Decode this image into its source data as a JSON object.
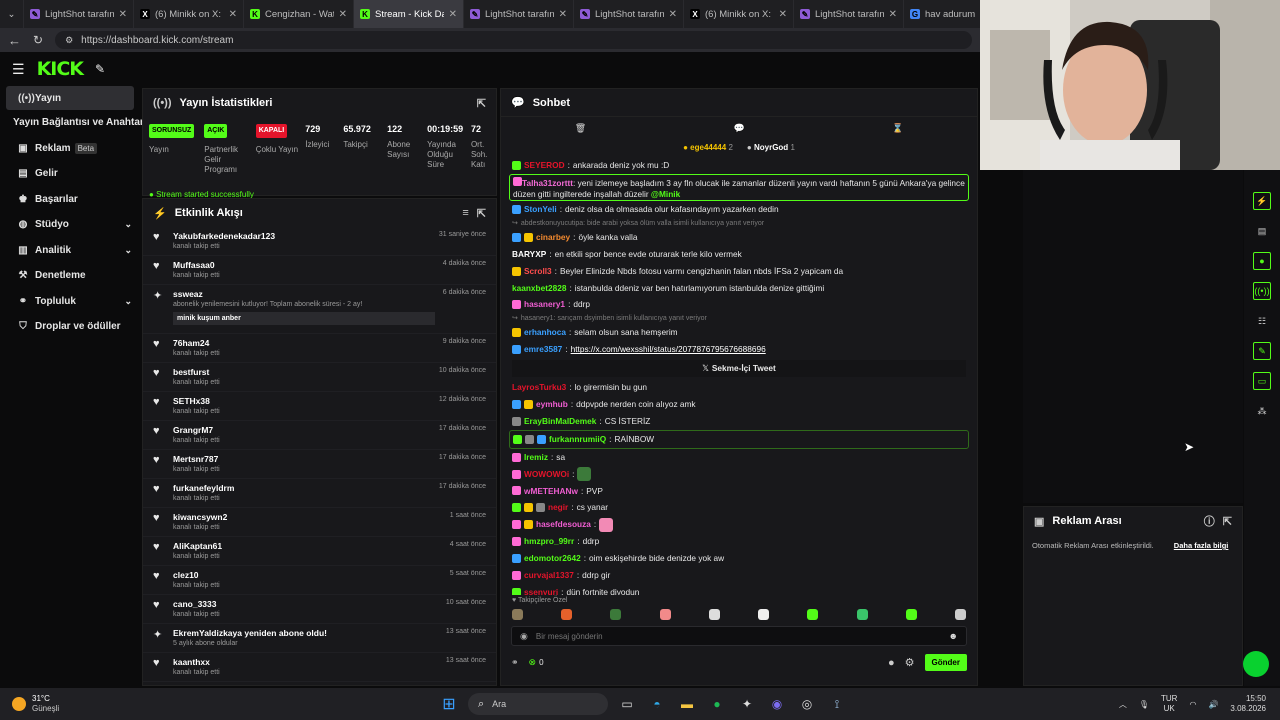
{
  "browser": {
    "tabs": [
      {
        "title": "LightShot tarafından",
        "icon": "lightshot-icon",
        "color": "#8e5bd6",
        "active": false
      },
      {
        "title": "(6) Minikk on X: \"NE",
        "icon": "x-icon",
        "color": "#000000",
        "active": false
      },
      {
        "title": "Cengizhan - Watch o",
        "icon": "kick-icon",
        "color": "#53fc18",
        "active": false
      },
      {
        "title": "Stream - Kick Dashb",
        "icon": "kick-icon",
        "color": "#53fc18",
        "active": true
      },
      {
        "title": "LightShot tarafından",
        "icon": "lightshot-icon",
        "color": "#8e5bd6",
        "active": false
      },
      {
        "title": "LightShot tarafından",
        "icon": "lightshot-icon",
        "color": "#8e5bd6",
        "active": false
      },
      {
        "title": "(6) Minikk on X: \"Mi",
        "icon": "x-icon",
        "color": "#000000",
        "active": false
      },
      {
        "title": "LightShot tarafından",
        "icon": "lightshot-icon",
        "color": "#8e5bd6",
        "active": false
      },
      {
        "title": "hav adurum",
        "icon": "google-icon",
        "color": "#4285f4",
        "active": false
      }
    ],
    "url": "https://dashboard.kick.com/stream"
  },
  "header": {
    "logo": "KICK"
  },
  "sidebar": {
    "items": [
      {
        "label": "Yayın",
        "icon": "stream-icon",
        "active": true
      },
      {
        "label": "Yayın Bağlantısı ve Anahtarı",
        "icon": "",
        "active": false
      },
      {
        "label": "Reklam",
        "icon": "ad-icon",
        "badge": "Beta"
      },
      {
        "label": "Gelir",
        "icon": "wallet-icon"
      },
      {
        "label": "Başarılar",
        "icon": "trophy-icon"
      },
      {
        "label": "Stüdyo",
        "icon": "studio-icon",
        "chevron": true
      },
      {
        "label": "Analitik",
        "icon": "chart-icon",
        "chevron": true
      },
      {
        "label": "Denetleme",
        "icon": "hammer-icon"
      },
      {
        "label": "Topluluk",
        "icon": "community-icon",
        "chevron": true
      },
      {
        "label": "Droplar ve ödüller",
        "icon": "gift-icon"
      }
    ]
  },
  "stats": {
    "title": "Yayın İstatistikleri",
    "items": [
      {
        "badge": "SORUNSUZ",
        "badge_color": "#53fc18",
        "label": "Yayın"
      },
      {
        "badge": "AÇIK",
        "badge_color": "#53fc18",
        "label": "Partnerlik Gelir Programı"
      },
      {
        "badge": "KAPALI",
        "badge_color": "#e5142b",
        "label": "Çoklu Yayın"
      },
      {
        "value": "729",
        "label": "İzleyici"
      },
      {
        "value": "65.972",
        "label": "Takipçi"
      },
      {
        "value": "122",
        "label": "Abone Sayısı"
      },
      {
        "value": "00:19:59",
        "label": "Yayında Olduğu Süre"
      },
      {
        "value": "72",
        "label": "Ort. Soh. Katı"
      }
    ],
    "status_message": "Stream started successfully"
  },
  "events": {
    "title": "Etkinlik Akışı",
    "items": [
      {
        "name": "Yakubfarkedenekadar123",
        "sub": "kanalı takip etti",
        "time": "31 saniye önce",
        "icon": "heart-icon"
      },
      {
        "name": "Muffasaa0",
        "sub": "kanalı takip etti",
        "time": "4 dakika önce",
        "icon": "heart-icon"
      },
      {
        "name": "ssweaz",
        "sub": "abonelik yenilemesini kutluyor! Toplam abonelik süresi - 2 ay!",
        "time": "6 dakika önce",
        "icon": "sub-icon",
        "note": "minik kuşum anber"
      },
      {
        "name": "76ham24",
        "sub": "kanalı takip etti",
        "time": "9 dakika önce",
        "icon": "heart-icon"
      },
      {
        "name": "bestfurst",
        "sub": "kanalı takip etti",
        "time": "10 dakika önce",
        "icon": "heart-icon"
      },
      {
        "name": "SETHx38",
        "sub": "kanalı takip etti",
        "time": "12 dakika önce",
        "icon": "heart-icon"
      },
      {
        "name": "GrangrM7",
        "sub": "kanalı takip etti",
        "time": "17 dakika önce",
        "icon": "heart-icon"
      },
      {
        "name": "Mertsnr787",
        "sub": "kanalı takip etti",
        "time": "17 dakika önce",
        "icon": "heart-icon"
      },
      {
        "name": "furkanefeyldrm",
        "sub": "kanalı takip etti",
        "time": "17 dakika önce",
        "icon": "heart-icon"
      },
      {
        "name": "kiwancsywn2",
        "sub": "kanalı takip etti",
        "time": "1 saat önce",
        "icon": "heart-icon"
      },
      {
        "name": "AliKaptan61",
        "sub": "kanalı takip etti",
        "time": "4 saat önce",
        "icon": "heart-icon"
      },
      {
        "name": "clez10",
        "sub": "kanalı takip etti",
        "time": "5 saat önce",
        "icon": "heart-icon"
      },
      {
        "name": "cano_3333",
        "sub": "kanalı takip etti",
        "time": "10 saat önce",
        "icon": "heart-icon"
      },
      {
        "name": "EkremYaldizkaya yeniden abone oldu!",
        "sub": "5 aylık abone oldular",
        "time": "13 saat önce",
        "icon": "sub-icon"
      },
      {
        "name": "kaanthxx",
        "sub": "kanalı takip etti",
        "time": "13 saat önce",
        "icon": "heart-icon"
      }
    ]
  },
  "chat": {
    "title": "Sohbet",
    "pinned_users": [
      {
        "name": "ege44444",
        "count": "2"
      },
      {
        "name": "NoyrGod",
        "count": "1"
      }
    ],
    "messages": [
      {
        "user": "SEYEROD",
        "color": "#e5142b",
        "text": "ankarada deniz yok mu :D",
        "badges": [
          "#53fc18"
        ]
      },
      {
        "user": "Talha31zorttt",
        "color": "#f36bd6",
        "text": "yeni izlemeye başladım 3 ay fln olucak ile zamanlar düzenli yayın vardı haftanın 5 günü Ankara'ya gelince düzen gitti ingilterede inşallah düzelir",
        "mention": "@Minik",
        "badges": [
          "#ff6ad5"
        ],
        "highlight": true
      },
      {
        "user": "StonYeli",
        "color": "#3aa0ff",
        "text": "deniz olsa da olmasada olur kafasındayım yazarken dedin",
        "badges": [
          "#3aa0ff"
        ]
      },
      {
        "sys": "abdestkonuyucutipa: bide arabi yoksa ölüm valla isimli kullanıcıya yanıt veriyor"
      },
      {
        "user": "cinarbey",
        "color": "#f38a2f",
        "text": "öyle kanka valla",
        "badges": [
          "#3aa0ff",
          "#f5c400"
        ]
      },
      {
        "user": "BARYXP",
        "color": "#ffffff",
        "text": "en etkili spor bence evde oturarak terle kilo vermek",
        "badges": []
      },
      {
        "user": "Scroll3",
        "color": "#ff4d4d",
        "text": "Beyler Elinizde Nbds fotosu varmı cengizhanin falan nbds İFSa 2 yapicam da",
        "badges": [
          "#f5c400"
        ]
      },
      {
        "user": "kaanxbet2828",
        "color": "#53fc18",
        "text": "istanbulda ddeniz var ben hatırlamıyorum istanbulda denize gittiğimi",
        "badges": []
      },
      {
        "user": "hasanery1",
        "color": "#f05ed2",
        "text": "ddrp",
        "badges": [
          "#ff6ad5"
        ]
      },
      {
        "sys": "hasanery1: sarıçam dsyimben isimli kullanıcıya yanıt veriyor"
      },
      {
        "user": "erhanhoca",
        "color": "#3aa0ff",
        "text": "selam olsun sana hemşerim",
        "badges": [
          "#f5c400"
        ]
      },
      {
        "user": "emre3587",
        "color": "#3aa0ff",
        "link": "https://x.com/wexsshil/status/2077876795676688696",
        "badges": [
          "#3aa0ff"
        ]
      },
      {
        "tweet": "Sekme-İçi Tweet"
      },
      {
        "user": "LayrosTurku3",
        "color": "#e5142b",
        "text": "lo girermisin bu gun",
        "badges": []
      },
      {
        "user": "eymhub",
        "color": "#f05ed2",
        "text": "ddpvpde nerden coin alıyoz amk",
        "badges": [
          "#3aa0ff",
          "#f5c400"
        ]
      },
      {
        "user": "ErayBinMalDemek",
        "color": "#53fc18",
        "text": "CS İSTERİZ",
        "badges": [
          "#888888"
        ]
      },
      {
        "user": "furkannrumiiQ",
        "color": "#53fc18",
        "text": "RAİNBOW",
        "badges": [
          "#53fc18",
          "#888888",
          "#3aa0ff"
        ],
        "highlight_small": true
      },
      {
        "user": "Iremiz",
        "color": "#53fc18",
        "text": "sa",
        "badges": [
          "#ff6ad5"
        ]
      },
      {
        "user": "WOWOWOi",
        "color": "#e5142b",
        "text": "",
        "badges": [
          "#ff6ad5"
        ],
        "emote": "pepe"
      },
      {
        "user": "wMETEHANw",
        "color": "#f05ed2",
        "text": "PVP",
        "badges": [
          "#ff6ad5"
        ]
      },
      {
        "user": "negir",
        "color": "#e5142b",
        "text": "cs yanar",
        "badges": [
          "#53fc18",
          "#f5c400",
          "#888888"
        ]
      },
      {
        "user": "hasefdesouza",
        "color": "#f05ed2",
        "text": "",
        "badges": [
          "#ff6ad5",
          "#f5c400"
        ],
        "emote": "hand"
      },
      {
        "user": "hmzpro_99rr",
        "color": "#53fc18",
        "text": "ddrp",
        "badges": [
          "#ff6ad5"
        ]
      },
      {
        "user": "edomotor2642",
        "color": "#53fc18",
        "text": "oim eskişehirde bide denizde yok aw",
        "badges": [
          "#3aa0ff"
        ]
      },
      {
        "user": "curvajal1337",
        "color": "#e5142b",
        "text": "ddrp gir",
        "badges": [
          "#ff6ad5"
        ]
      },
      {
        "user": "ssenyuri",
        "color": "#e5142b",
        "text": "dün fortnite diyodun",
        "badges": [
          "#53fc18"
        ]
      }
    ],
    "followers_only": "Takipçilere Özel",
    "input_placeholder": "Bir mesaj gönderin",
    "points": "0",
    "send_label": "Gönder"
  },
  "ads": {
    "title": "Reklam Arası",
    "text": "Otomatik Reklam Arası etkinleştirildi.",
    "link": "Daha fazla bilgi"
  },
  "taskbar": {
    "weather_temp": "31°C",
    "weather_desc": "Güneşli",
    "search": "Ara",
    "lang": "TUR",
    "lang2": "UK",
    "time": "15:50",
    "date": "3.08.2026"
  }
}
